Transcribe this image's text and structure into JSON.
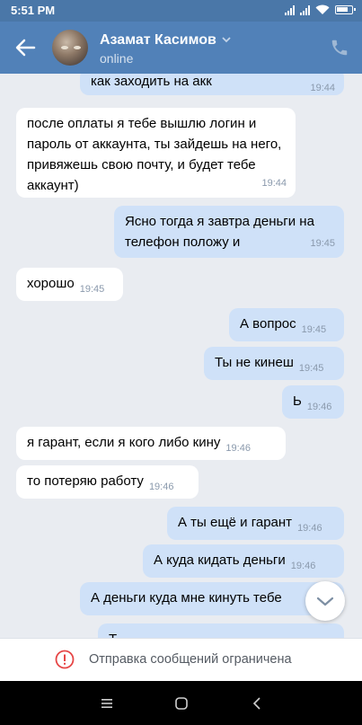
{
  "status_bar": {
    "time": "5:51 PM"
  },
  "header": {
    "name": "Азамат Касимов",
    "status": "online"
  },
  "messages": [
    {
      "dir": "out",
      "text": "как заходить на акк",
      "time": "19:44"
    },
    {
      "dir": "in",
      "text": "после оплаты я тебе вышлю логин и пароль от аккаунта, ты зайдешь на него, привяжешь свою почту, и будет тебе аккаунт)",
      "time": "19:44"
    },
    {
      "dir": "out",
      "text": "Ясно тогда я завтра деньги на телефон положу и",
      "time": "19:45"
    },
    {
      "dir": "in",
      "text": "хорошо",
      "time": "19:45"
    },
    {
      "dir": "out",
      "text": "А вопрос",
      "time": "19:45"
    },
    {
      "dir": "out",
      "text": "Ты не кинеш",
      "time": "19:45"
    },
    {
      "dir": "out",
      "text": "Ь",
      "time": "19:46"
    },
    {
      "dir": "in",
      "text": "я гарант, если я кого либо кину",
      "time": "19:46"
    },
    {
      "dir": "in",
      "text": "то потеряю работу",
      "time": "19:46"
    },
    {
      "dir": "out",
      "text": "А ты ещё и гарант",
      "time": "19:46"
    },
    {
      "dir": "out",
      "text": "А куда кидать деньги",
      "time": "19:46"
    },
    {
      "dir": "out",
      "text": "А деньги куда мне кинуть тебе",
      "time": ""
    },
    {
      "dir": "out",
      "text": "Т",
      "time": ""
    }
  ],
  "restriction": {
    "text": "Отправка сообщений ограничена"
  },
  "colors": {
    "header": "#5181b8",
    "outgoing": "#cfe1f8",
    "incoming": "#ffffff",
    "warning": "#e64646"
  }
}
